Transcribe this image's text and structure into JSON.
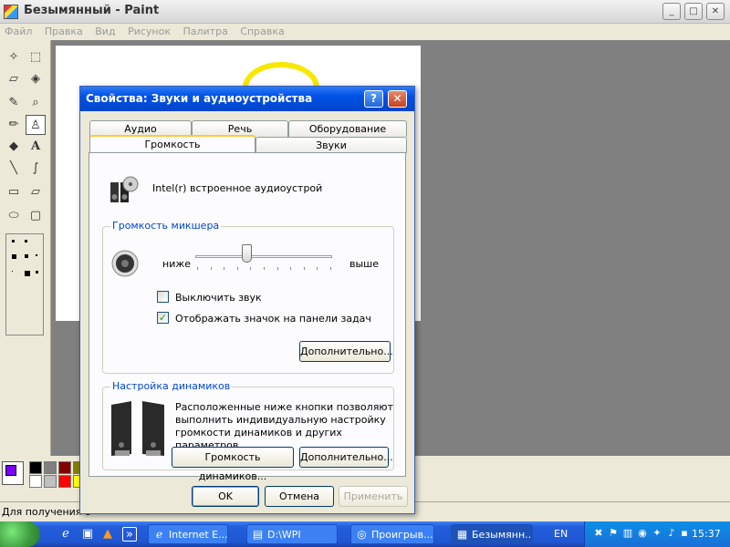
{
  "paint": {
    "title": "Безымянный - Paint",
    "menu": [
      "Файл",
      "Правка",
      "Вид",
      "Рисунок",
      "Палитра",
      "Справка"
    ],
    "status_text": "Для получения с",
    "palette_colors": [
      "#000000",
      "#808080",
      "#800000",
      "#808000",
      "#ffffff",
      "#c0c0c0",
      "#ff0000",
      "#ffff00"
    ],
    "foreground_color": "#7a00ff"
  },
  "dialog": {
    "title": "Свойства: Звуки и аудиоустройства",
    "tabs_row1": [
      "Аудио",
      "Речь",
      "Оборудование"
    ],
    "tabs_row2": [
      "Громкость",
      "Звуки"
    ],
    "active_tab": "Громкость",
    "device_name": "Intel(r) встроенное аудиоустрой",
    "mixer": {
      "group_title": "Громкость микшера",
      "low_label": "ниже",
      "high_label": "выше",
      "volume_fraction": 0.37
    },
    "mute_label": "Выключить звук",
    "mute_checked": false,
    "tray_icon_label": "Отображать значок на панели задач",
    "tray_icon_checked": true,
    "advanced_button": "Дополнительно...",
    "speakers": {
      "group_title": "Настройка динамиков",
      "description": "Расположенные ниже кнопки позволяют выполнить индивидуальную настройку громкости динамиков и других параметров.",
      "volume_button": "Громкость динамиков...",
      "advanced_button": "Дополнительно..."
    },
    "ok_button": "OK",
    "cancel_button": "Отмена",
    "apply_button": "Применить"
  },
  "taskbar": {
    "buttons": [
      "Internet E...",
      "D:\\WPI",
      "Проигрыв...",
      "Безымянн..."
    ],
    "language": "EN",
    "clock": "15:37"
  }
}
